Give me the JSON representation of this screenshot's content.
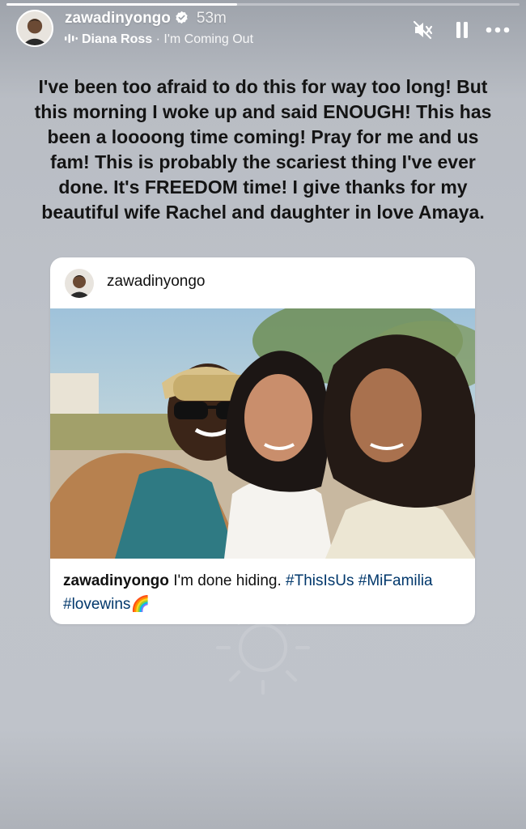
{
  "story": {
    "progress": 0.45
  },
  "header": {
    "username": "zawadinyongo",
    "time": "53m",
    "music": {
      "artist": "Diana Ross",
      "separator": "·",
      "song": "I'm Coming Out"
    }
  },
  "caption": "I've been too afraid to do this for way too long! But this morning I woke up and said ENOUGH! This has been a loooong time coming! Pray for me and us fam! This is probably the scariest thing I've ever done. It's FREEDOM time! I give thanks for my beautiful wife Rachel and daughter in love Amaya.",
  "post": {
    "username": "zawadinyongo",
    "caption_user": "zawadinyongo",
    "caption_text": "I'm done hiding.",
    "hashtags": [
      "#ThisIsUs",
      "#MiFamilia",
      "#lovewins"
    ],
    "emoji": "🌈"
  },
  "icons": {
    "verified": "verified-badge-icon",
    "music": "audio-bars-icon",
    "mute": "speaker-muted-icon",
    "pause": "pause-icon",
    "more": "more-horizontal-icon"
  },
  "colors": {
    "hashtag": "#00376b",
    "verified": "#0095f6",
    "background": "#c0c4cb"
  }
}
